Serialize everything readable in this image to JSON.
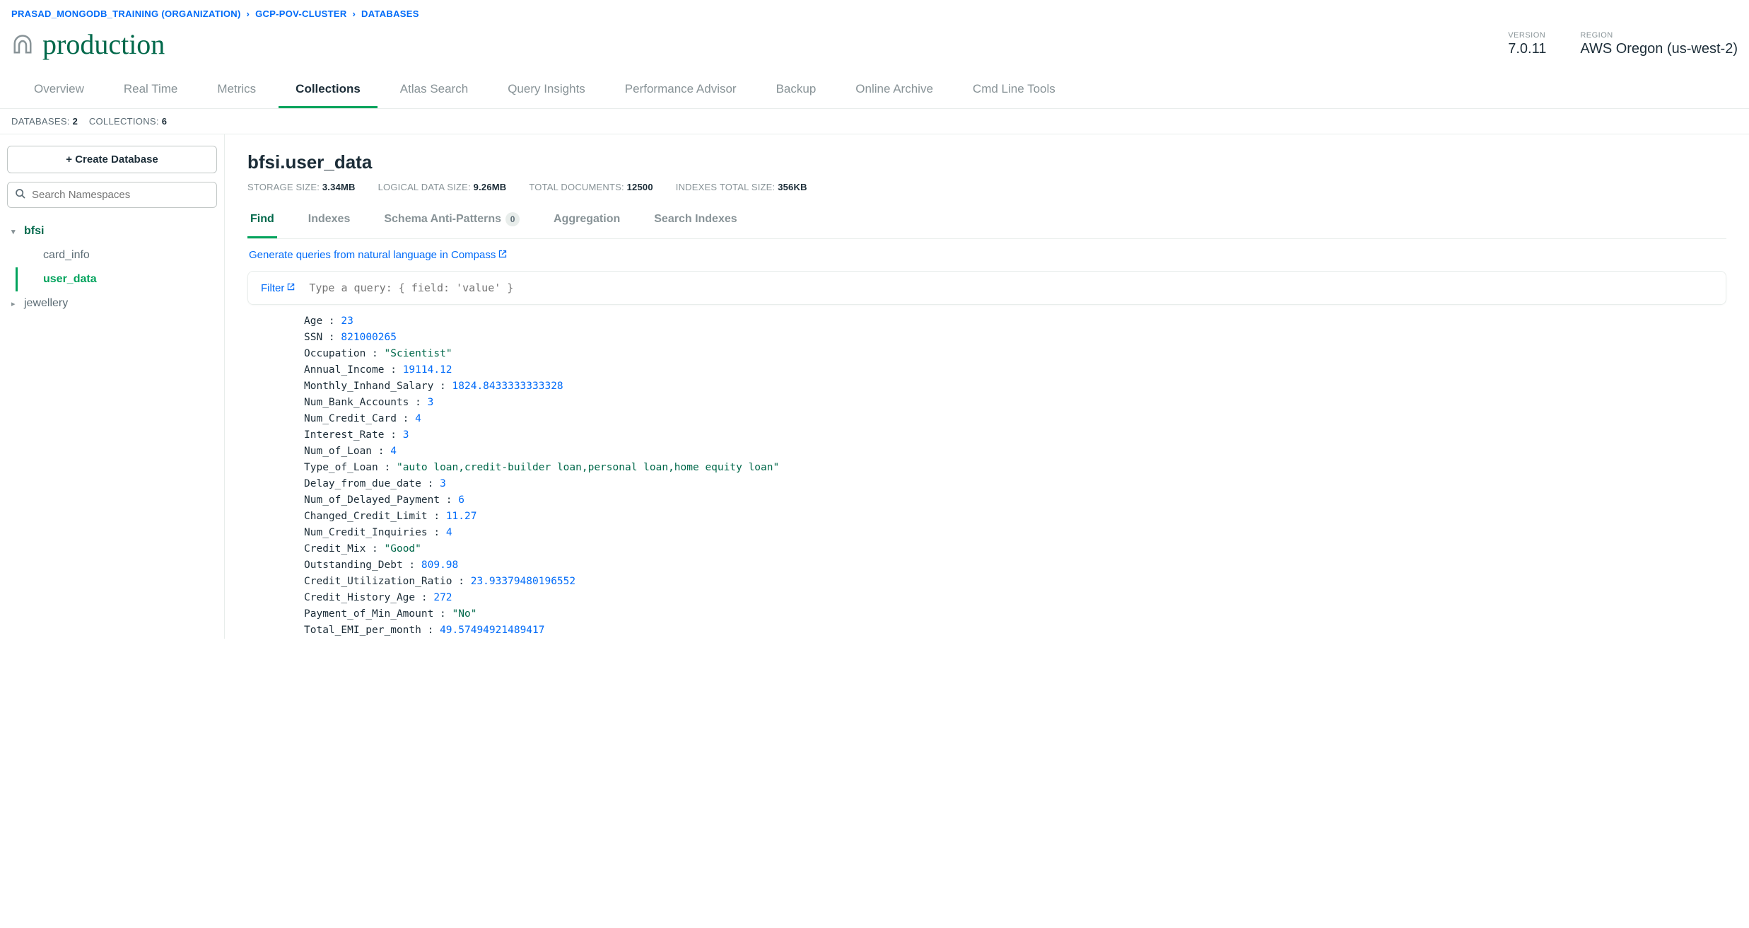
{
  "breadcrumb": {
    "org": "PRASAD_MONGODB_TRAINING (ORGANIZATION)",
    "cluster": "GCP-POV-CLUSTER",
    "section": "DATABASES"
  },
  "header": {
    "title": "production",
    "version_label": "VERSION",
    "version_value": "7.0.11",
    "region_label": "REGION",
    "region_value": "AWS Oregon (us-west-2)"
  },
  "tabs": [
    {
      "label": "Overview",
      "active": false
    },
    {
      "label": "Real Time",
      "active": false
    },
    {
      "label": "Metrics",
      "active": false
    },
    {
      "label": "Collections",
      "active": true
    },
    {
      "label": "Atlas Search",
      "active": false
    },
    {
      "label": "Query Insights",
      "active": false
    },
    {
      "label": "Performance Advisor",
      "active": false
    },
    {
      "label": "Backup",
      "active": false
    },
    {
      "label": "Online Archive",
      "active": false
    },
    {
      "label": "Cmd Line Tools",
      "active": false
    }
  ],
  "stats": {
    "databases_label": "DATABASES:",
    "databases_count": "2",
    "collections_label": "COLLECTIONS:",
    "collections_count": "6"
  },
  "sidebar": {
    "create_label": "Create Database",
    "search_placeholder": "Search Namespaces",
    "databases": [
      {
        "name": "bfsi",
        "expanded": true,
        "collections": [
          {
            "name": "card_info",
            "active": false
          },
          {
            "name": "user_data",
            "active": true
          }
        ]
      },
      {
        "name": "jewellery",
        "expanded": false,
        "collections": []
      }
    ]
  },
  "collection": {
    "title": "bfsi.user_data",
    "stats": {
      "storage_label": "STORAGE SIZE:",
      "storage_value": "3.34MB",
      "logical_label": "LOGICAL DATA SIZE:",
      "logical_value": "9.26MB",
      "docs_label": "TOTAL DOCUMENTS:",
      "docs_value": "12500",
      "idx_label": "INDEXES TOTAL SIZE:",
      "idx_value": "356KB"
    },
    "subtabs": [
      {
        "label": "Find",
        "active": true,
        "badge": null
      },
      {
        "label": "Indexes",
        "active": false,
        "badge": null
      },
      {
        "label": "Schema Anti-Patterns",
        "active": false,
        "badge": "0"
      },
      {
        "label": "Aggregation",
        "active": false,
        "badge": null
      },
      {
        "label": "Search Indexes",
        "active": false,
        "badge": null
      }
    ],
    "compass_link": "Generate queries from natural language in Compass",
    "filter_label": "Filter",
    "filter_placeholder": "Type a query: { field: 'value' }"
  },
  "document_fields": [
    {
      "key": "Age",
      "type": "num",
      "value": "23"
    },
    {
      "key": "SSN",
      "type": "num",
      "value": "821000265"
    },
    {
      "key": "Occupation",
      "type": "str",
      "value": "\"Scientist\""
    },
    {
      "key": "Annual_Income",
      "type": "num",
      "value": "19114.12"
    },
    {
      "key": "Monthly_Inhand_Salary",
      "type": "num",
      "value": "1824.8433333333328"
    },
    {
      "key": "Num_Bank_Accounts",
      "type": "num",
      "value": "3"
    },
    {
      "key": "Num_Credit_Card",
      "type": "num",
      "value": "4"
    },
    {
      "key": "Interest_Rate",
      "type": "num",
      "value": "3"
    },
    {
      "key": "Num_of_Loan",
      "type": "num",
      "value": "4"
    },
    {
      "key": "Type_of_Loan",
      "type": "str",
      "value": "\"auto loan,credit-builder loan,personal loan,home equity loan\""
    },
    {
      "key": "Delay_from_due_date",
      "type": "num",
      "value": "3"
    },
    {
      "key": "Num_of_Delayed_Payment",
      "type": "num",
      "value": "6"
    },
    {
      "key": "Changed_Credit_Limit",
      "type": "num",
      "value": "11.27"
    },
    {
      "key": "Num_Credit_Inquiries",
      "type": "num",
      "value": "4"
    },
    {
      "key": "Credit_Mix",
      "type": "str",
      "value": "\"Good\""
    },
    {
      "key": "Outstanding_Debt",
      "type": "num",
      "value": "809.98"
    },
    {
      "key": "Credit_Utilization_Ratio",
      "type": "num",
      "value": "23.93379480196552"
    },
    {
      "key": "Credit_History_Age",
      "type": "num",
      "value": "272"
    },
    {
      "key": "Payment_of_Min_Amount",
      "type": "str",
      "value": "\"No\""
    },
    {
      "key": "Total_EMI_per_month",
      "type": "num",
      "value": "49.57494921489417"
    }
  ]
}
